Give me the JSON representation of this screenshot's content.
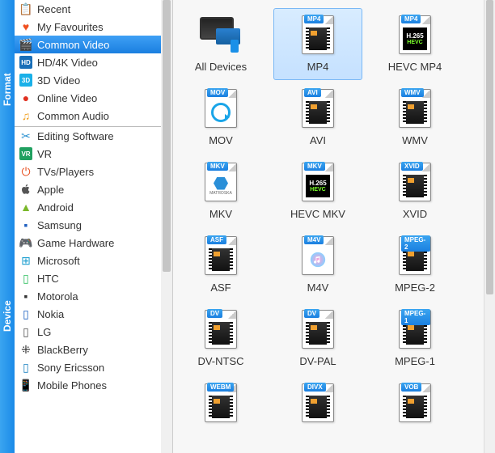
{
  "vtabs": {
    "format": "Format",
    "device": "Device"
  },
  "sidebar": {
    "format_items": [
      {
        "label": "Recent",
        "icon": "📋",
        "color": "#d88a30"
      },
      {
        "label": "My Favourites",
        "icon": "♥",
        "color": "#f05020"
      },
      {
        "label": "Common Video",
        "icon": "🎬",
        "color": "#2a80d0",
        "selected": true
      },
      {
        "label": "HD/4K Video",
        "icon": "HD",
        "color": "#1a6fb8",
        "badge": true
      },
      {
        "label": "3D Video",
        "icon": "3D",
        "color": "#1ab0e8",
        "badge": true
      },
      {
        "label": "Online Video",
        "icon": "●",
        "color": "#e03020"
      },
      {
        "label": "Common Audio",
        "icon": "♫",
        "color": "#f0a020"
      }
    ],
    "device_items": [
      {
        "label": "Editing Software",
        "icon": "✂",
        "color": "#2a90d0"
      },
      {
        "label": "VR",
        "icon": "VR",
        "color": "#20a060",
        "badge": true
      },
      {
        "label": "TVs/Players",
        "icon": "⏻",
        "color": "#e85020"
      },
      {
        "label": "Apple",
        "icon": "",
        "apple": true,
        "color": "#555"
      },
      {
        "label": "Android",
        "icon": "▲",
        "color": "#7ab82a"
      },
      {
        "label": "Samsung",
        "icon": "▪",
        "color": "#2060c0"
      },
      {
        "label": "Game Hardware",
        "icon": "🎮",
        "color": "#888"
      },
      {
        "label": "Microsoft",
        "icon": "⊞",
        "color": "#20a0d0"
      },
      {
        "label": "HTC",
        "icon": "▯",
        "color": "#30c060"
      },
      {
        "label": "Motorola",
        "icon": "▪",
        "color": "#333"
      },
      {
        "label": "Nokia",
        "icon": "▯",
        "color": "#1a60c0"
      },
      {
        "label": "LG",
        "icon": "▯",
        "color": "#555"
      },
      {
        "label": "BlackBerry",
        "icon": "⁜",
        "color": "#222"
      },
      {
        "label": "Sony Ericsson",
        "icon": "▯",
        "color": "#1a80c0"
      },
      {
        "label": "Mobile Phones",
        "icon": "📱",
        "color": "#2070b0"
      }
    ]
  },
  "formats": [
    {
      "label": "All Devices",
      "type": "devices"
    },
    {
      "label": "MP4",
      "badge": "MP4",
      "type": "film",
      "selected": true
    },
    {
      "label": "HEVC MP4",
      "badge": "MP4",
      "type": "hevc"
    },
    {
      "label": "MOV",
      "badge": "MOV",
      "type": "qt"
    },
    {
      "label": "AVI",
      "badge": "AVI",
      "type": "film"
    },
    {
      "label": "WMV",
      "badge": "WMV",
      "type": "film"
    },
    {
      "label": "MKV",
      "badge": "MKV",
      "type": "mkv"
    },
    {
      "label": "HEVC MKV",
      "badge": "MKV",
      "type": "hevc"
    },
    {
      "label": "XVID",
      "badge": "XVID",
      "type": "film"
    },
    {
      "label": "ASF",
      "badge": "ASF",
      "type": "film"
    },
    {
      "label": "M4V",
      "badge": "M4V",
      "type": "itunes"
    },
    {
      "label": "MPEG-2",
      "badge": "MPEG-2",
      "type": "film"
    },
    {
      "label": "DV-NTSC",
      "badge": "DV",
      "type": "film"
    },
    {
      "label": "DV-PAL",
      "badge": "DV",
      "type": "film"
    },
    {
      "label": "MPEG-1",
      "badge": "MPEG-1",
      "type": "film"
    },
    {
      "label": "",
      "badge": "WEBM",
      "type": "film",
      "partial": true
    },
    {
      "label": "",
      "badge": "DIVX",
      "type": "film",
      "partial": true
    },
    {
      "label": "",
      "badge": "VOB",
      "type": "film",
      "partial": true
    }
  ]
}
